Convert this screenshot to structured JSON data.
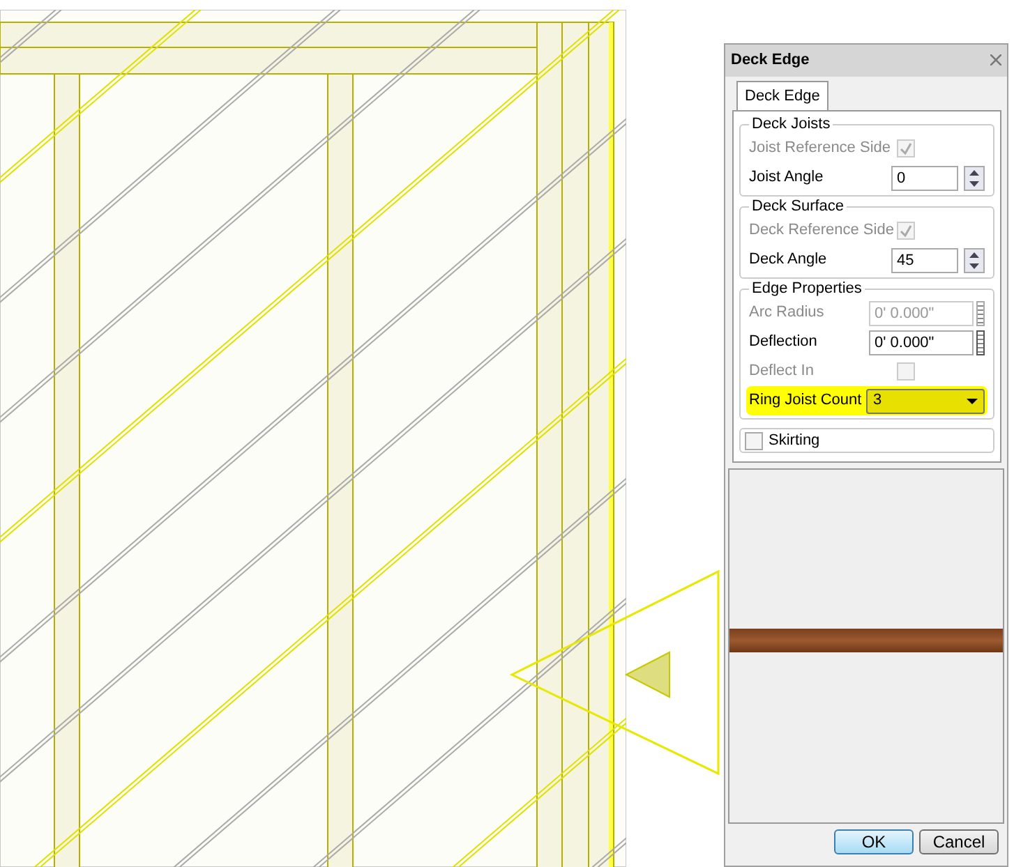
{
  "window": {
    "title": "Deck Edge"
  },
  "tabs": [
    {
      "label": "Deck Edge",
      "selected": true
    }
  ],
  "groups": [
    {
      "title": "Deck Joists",
      "rows": [
        {
          "kind": "checkbox",
          "label": "Joist Reference Side",
          "checked": true,
          "disabled": true,
          "highlighted": false
        },
        {
          "kind": "spin",
          "label": "Joist Angle",
          "value": "0",
          "disabled": false,
          "highlighted": false
        }
      ]
    },
    {
      "title": "Deck Surface",
      "rows": [
        {
          "kind": "checkbox",
          "label": "Deck Reference Side",
          "checked": true,
          "disabled": true,
          "highlighted": false
        },
        {
          "kind": "spin",
          "label": "Deck Angle",
          "value": "45",
          "disabled": false,
          "highlighted": false
        }
      ]
    },
    {
      "title": "Edge Properties",
      "rows": [
        {
          "kind": "dimension",
          "label": "Arc Radius",
          "value": "0' 0.000\"",
          "disabled": true,
          "highlighted": false
        },
        {
          "kind": "dimension",
          "label": "Deflection",
          "value": "0' 0.000\"",
          "disabled": false,
          "highlighted": false
        },
        {
          "kind": "checkbox",
          "label": "Deflect In",
          "checked": false,
          "disabled": true,
          "highlighted": false
        },
        {
          "kind": "dropdown",
          "label": "Ring Joist Count",
          "value": "3",
          "disabled": false,
          "highlighted": true
        }
      ]
    }
  ],
  "skirting": {
    "label": "Skirting",
    "checked": false
  },
  "buttons": [
    {
      "label": "OK",
      "default": true
    },
    {
      "label": "Cancel",
      "default": false
    }
  ]
}
